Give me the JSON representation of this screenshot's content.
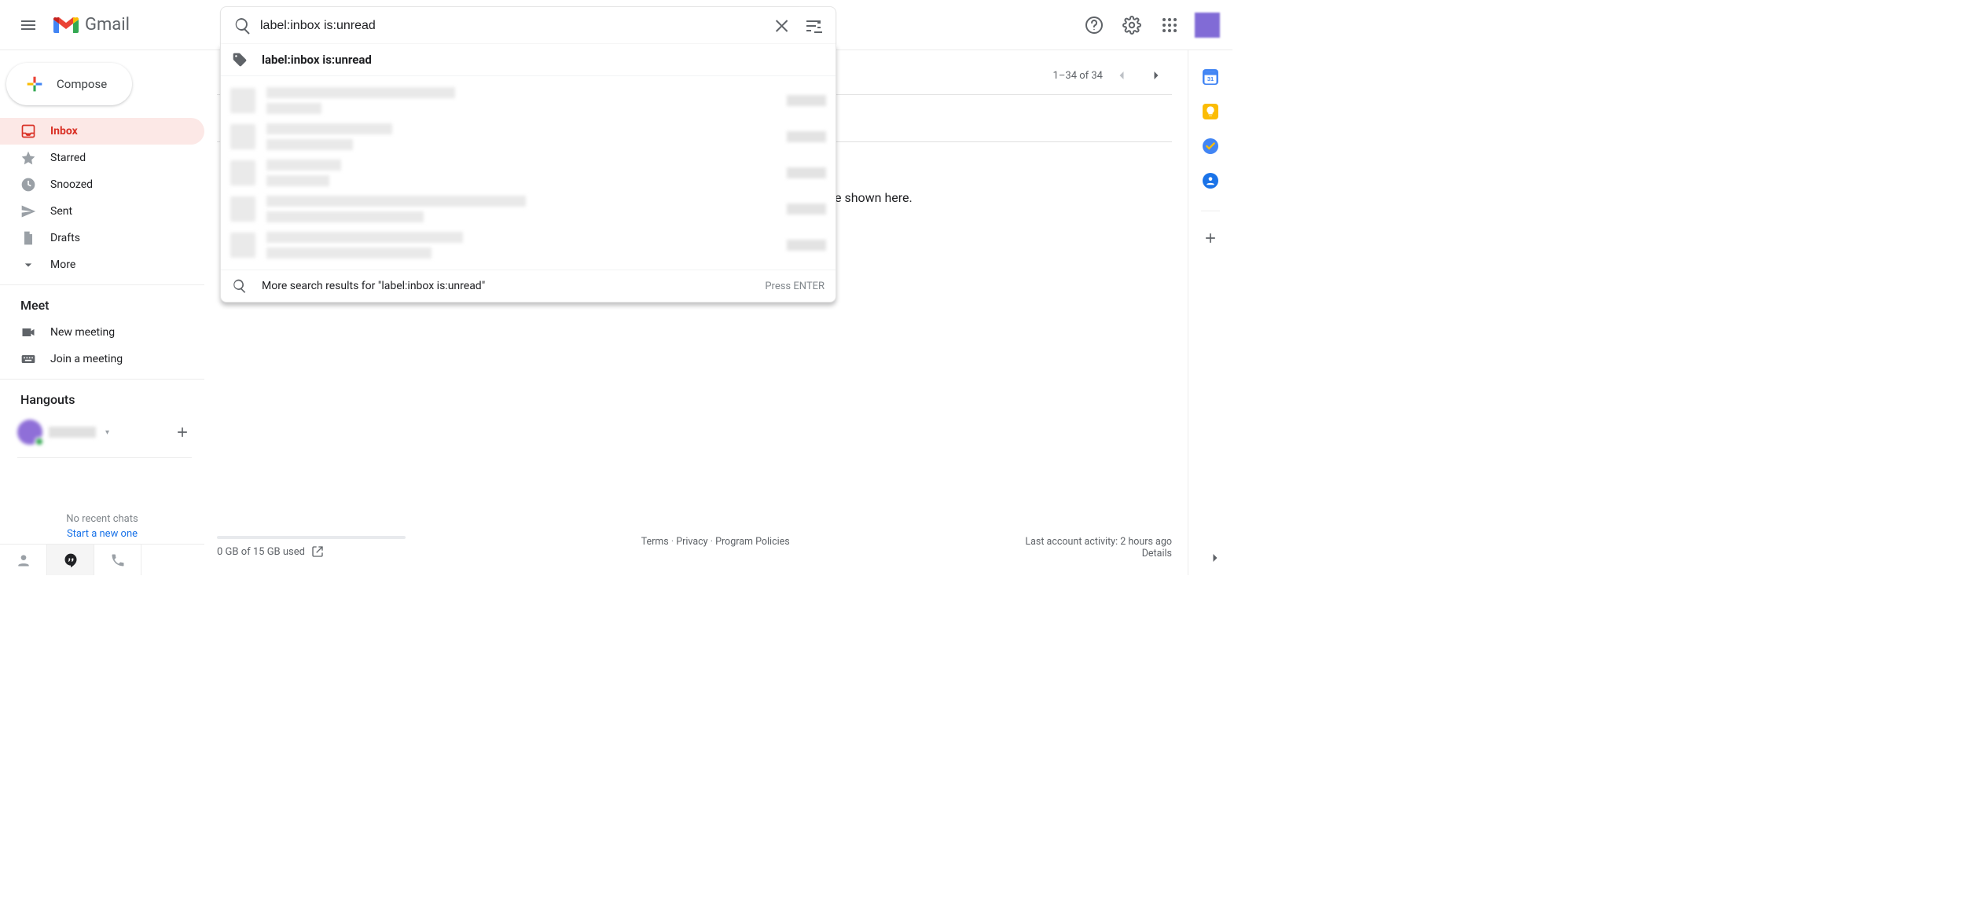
{
  "header": {
    "product_name": "Gmail",
    "search": {
      "value": "label:inbox is:unread",
      "top_suggestion": "label:inbox is:unread",
      "more_results": "More search results for \"label:inbox is:unread\"",
      "enter_hint": "Press ENTER"
    }
  },
  "sidebar": {
    "compose": "Compose",
    "nav": [
      {
        "key": "inbox",
        "label": "Inbox",
        "active": true
      },
      {
        "key": "starred",
        "label": "Starred",
        "active": false
      },
      {
        "key": "snoozed",
        "label": "Snoozed",
        "active": false
      },
      {
        "key": "sent",
        "label": "Sent",
        "active": false
      },
      {
        "key": "drafts",
        "label": "Drafts",
        "active": false
      },
      {
        "key": "more",
        "label": "More",
        "active": false
      }
    ],
    "meet": {
      "heading": "Meet",
      "new_meeting": "New meeting",
      "join_meeting": "Join a meeting"
    },
    "hangouts": {
      "heading": "Hangouts",
      "no_recent": "No recent chats",
      "start_new": "Start a new one"
    }
  },
  "toolbar": {
    "range": "1–34 of 34"
  },
  "content": {
    "peek_text": "e shown here."
  },
  "footer": {
    "storage": "0 GB of 15 GB used",
    "terms": "Terms",
    "privacy": "Privacy",
    "policies": "Program Policies",
    "activity": "Last account activity: 2 hours ago",
    "details": "Details"
  }
}
